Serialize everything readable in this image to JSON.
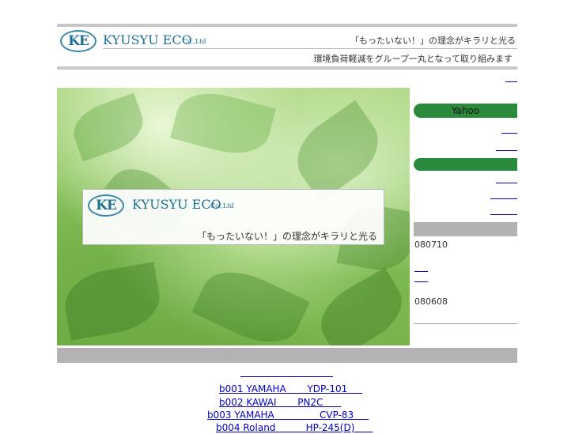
{
  "header": {
    "logo_mark": "KE",
    "brand_name": "KYUSYU ECO",
    "brand_suffix": "Co.,Ltd",
    "tagline_1": "「もったいない！」の理念がキラリと光る",
    "tagline_2": "環境負荷軽減をグループ一丸となって取り組みます"
  },
  "hero": {
    "logo_mark": "KE",
    "brand_name": "KYUSYU ECO",
    "brand_suffix": "Co.,Ltd",
    "tagline": "「もったいない！」の理念がキラリと光る"
  },
  "sidebar": {
    "top_link": " ",
    "pill_1_label": "Yahoo",
    "pill_2_label": "",
    "news": [
      {
        "date": "080710"
      },
      {
        "date": "080608"
      }
    ]
  },
  "products": [
    {
      "code": "b001",
      "maker": "YAMAHA",
      "model": "YDP-101"
    },
    {
      "code": "b002",
      "maker": "KAWAI",
      "model": "PN2C"
    },
    {
      "code": "b003",
      "maker": "YAMAHA",
      "model": "CVP-83"
    },
    {
      "code": "b004",
      "maker": "Roland",
      "model": "HP-245(D)"
    }
  ],
  "colors": {
    "accent_green": "#2a8a3c",
    "link_blue": "#0000cc",
    "rule_gray": "#c8c8c8",
    "brand_teal": "#1f6f96"
  }
}
